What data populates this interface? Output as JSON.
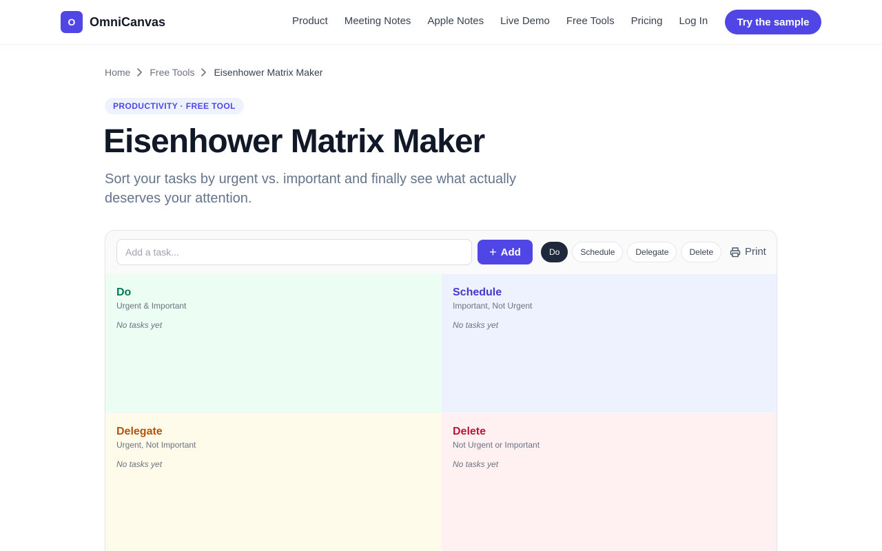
{
  "header": {
    "logo_letter": "O",
    "brand": "OmniCanvas",
    "nav": [
      "Product",
      "Meeting Notes",
      "Apple Notes",
      "Live Demo",
      "Free Tools",
      "Pricing",
      "Log In"
    ],
    "cta": "Try the sample"
  },
  "breadcrumb": [
    "Home",
    "Free Tools",
    "Eisenhower Matrix Maker"
  ],
  "tag": "PRODUCTIVITY · FREE TOOL",
  "title": "Eisenhower Matrix Maker",
  "subtitle": "Sort your tasks by urgent vs. important and finally see what actually deserves your attention.",
  "tool": {
    "input_placeholder": "Add a task...",
    "input_value": "",
    "add_label": "Add",
    "filters": [
      "Do",
      "Schedule",
      "Delegate",
      "Delete"
    ],
    "active_filter": "Do",
    "print_label": "Print",
    "quadrants": [
      {
        "title": "Do",
        "subtitle": "Urgent & Important",
        "empty": "No tasks yet",
        "color": "#047857",
        "bg": "#ecfdf3"
      },
      {
        "title": "Schedule",
        "subtitle": "Important, Not Urgent",
        "empty": "No tasks yet",
        "color": "#4338ca",
        "bg": "#eef2ff"
      },
      {
        "title": "Delegate",
        "subtitle": "Urgent, Not Important",
        "empty": "No tasks yet",
        "color": "#b45309",
        "bg": "#fefbea"
      },
      {
        "title": "Delete",
        "subtitle": "Not Urgent or Important",
        "empty": "No tasks yet",
        "color": "#be123c",
        "bg": "#fff1f2"
      }
    ]
  },
  "colors": {
    "accent": "#4f46e5",
    "active_chip": "#1e293b"
  }
}
